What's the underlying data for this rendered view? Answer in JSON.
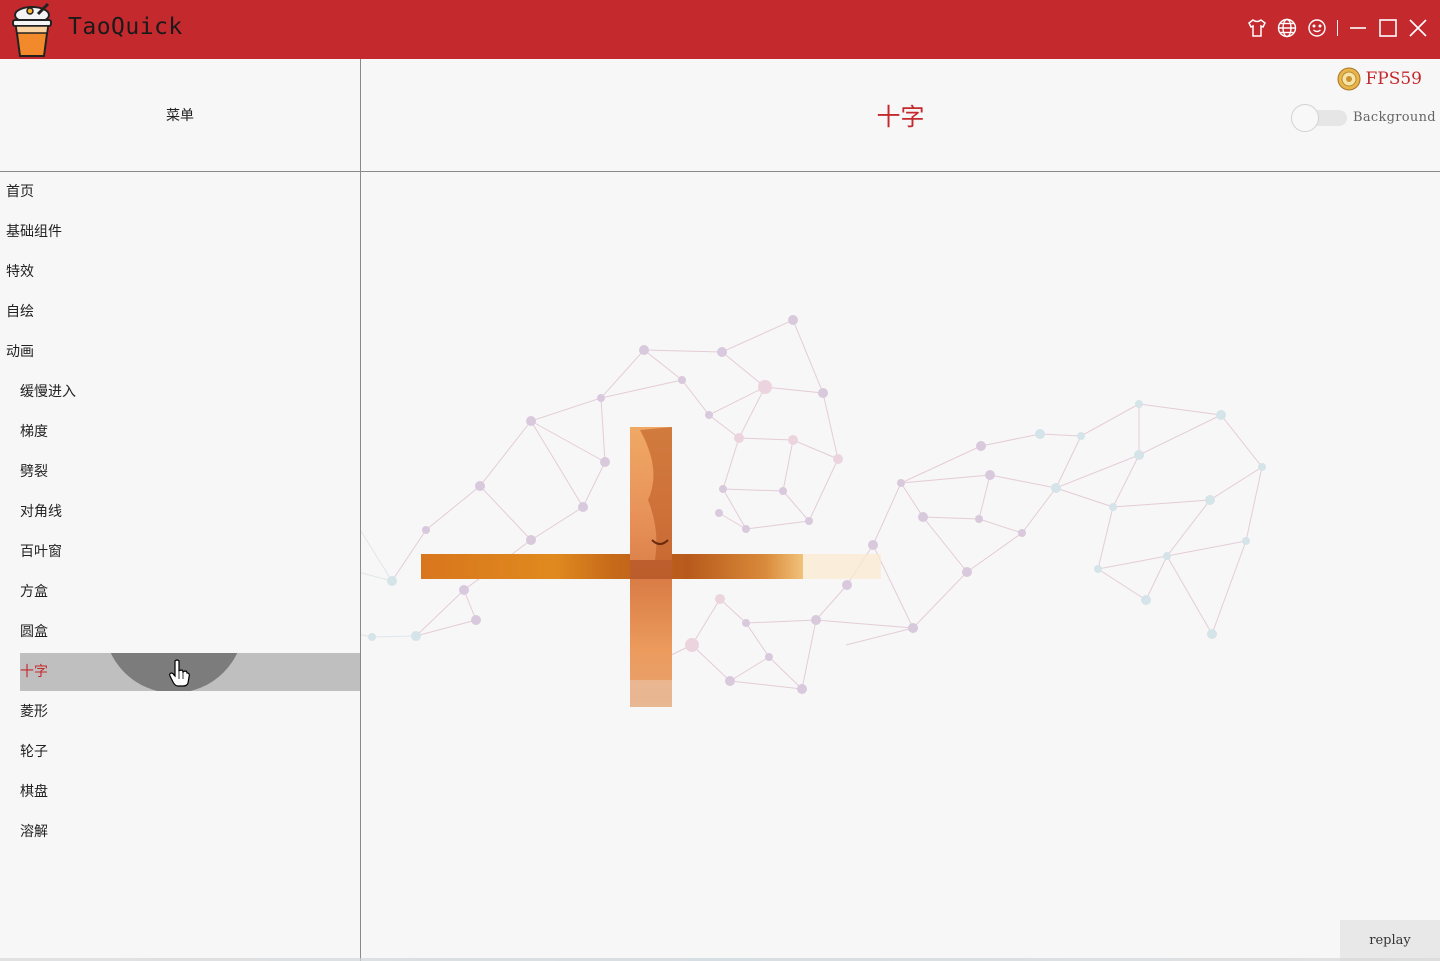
{
  "app": {
    "title": "TaoQuick",
    "logo_icon": "bubble-tea-cup-icon",
    "brand_color": "#c4292e"
  },
  "titlebar": {
    "buttons": [
      {
        "icon": "skin-shirt-icon"
      },
      {
        "icon": "globe-language-icon"
      },
      {
        "icon": "smiley-about-icon"
      },
      {
        "icon": "minimize-icon"
      },
      {
        "icon": "maximize-icon"
      },
      {
        "icon": "close-icon"
      }
    ]
  },
  "sidebar": {
    "header": "菜单",
    "items": [
      {
        "label": "首页",
        "level": 0
      },
      {
        "label": "基础组件",
        "level": 0
      },
      {
        "label": "特效",
        "level": 0
      },
      {
        "label": "自绘",
        "level": 0
      },
      {
        "label": "动画",
        "level": 0
      },
      {
        "label": "缓慢进入",
        "level": 1
      },
      {
        "label": "梯度",
        "level": 1
      },
      {
        "label": "劈裂",
        "level": 1
      },
      {
        "label": "对角线",
        "level": 1
      },
      {
        "label": "百叶窗",
        "level": 1
      },
      {
        "label": "方盒",
        "level": 1
      },
      {
        "label": "圆盒",
        "level": 1
      },
      {
        "label": "十字",
        "level": 1,
        "selected": true
      },
      {
        "label": "菱形",
        "level": 1
      },
      {
        "label": "轮子",
        "level": 1
      },
      {
        "label": "棋盘",
        "level": 1
      },
      {
        "label": "溶解",
        "level": 1
      }
    ]
  },
  "main": {
    "page_title": "十字",
    "fps": {
      "text": "FPS59",
      "icon": "fps-gauge-icon"
    },
    "background_toggle": {
      "label": "Background",
      "on": false
    },
    "replay_label": "replay"
  }
}
